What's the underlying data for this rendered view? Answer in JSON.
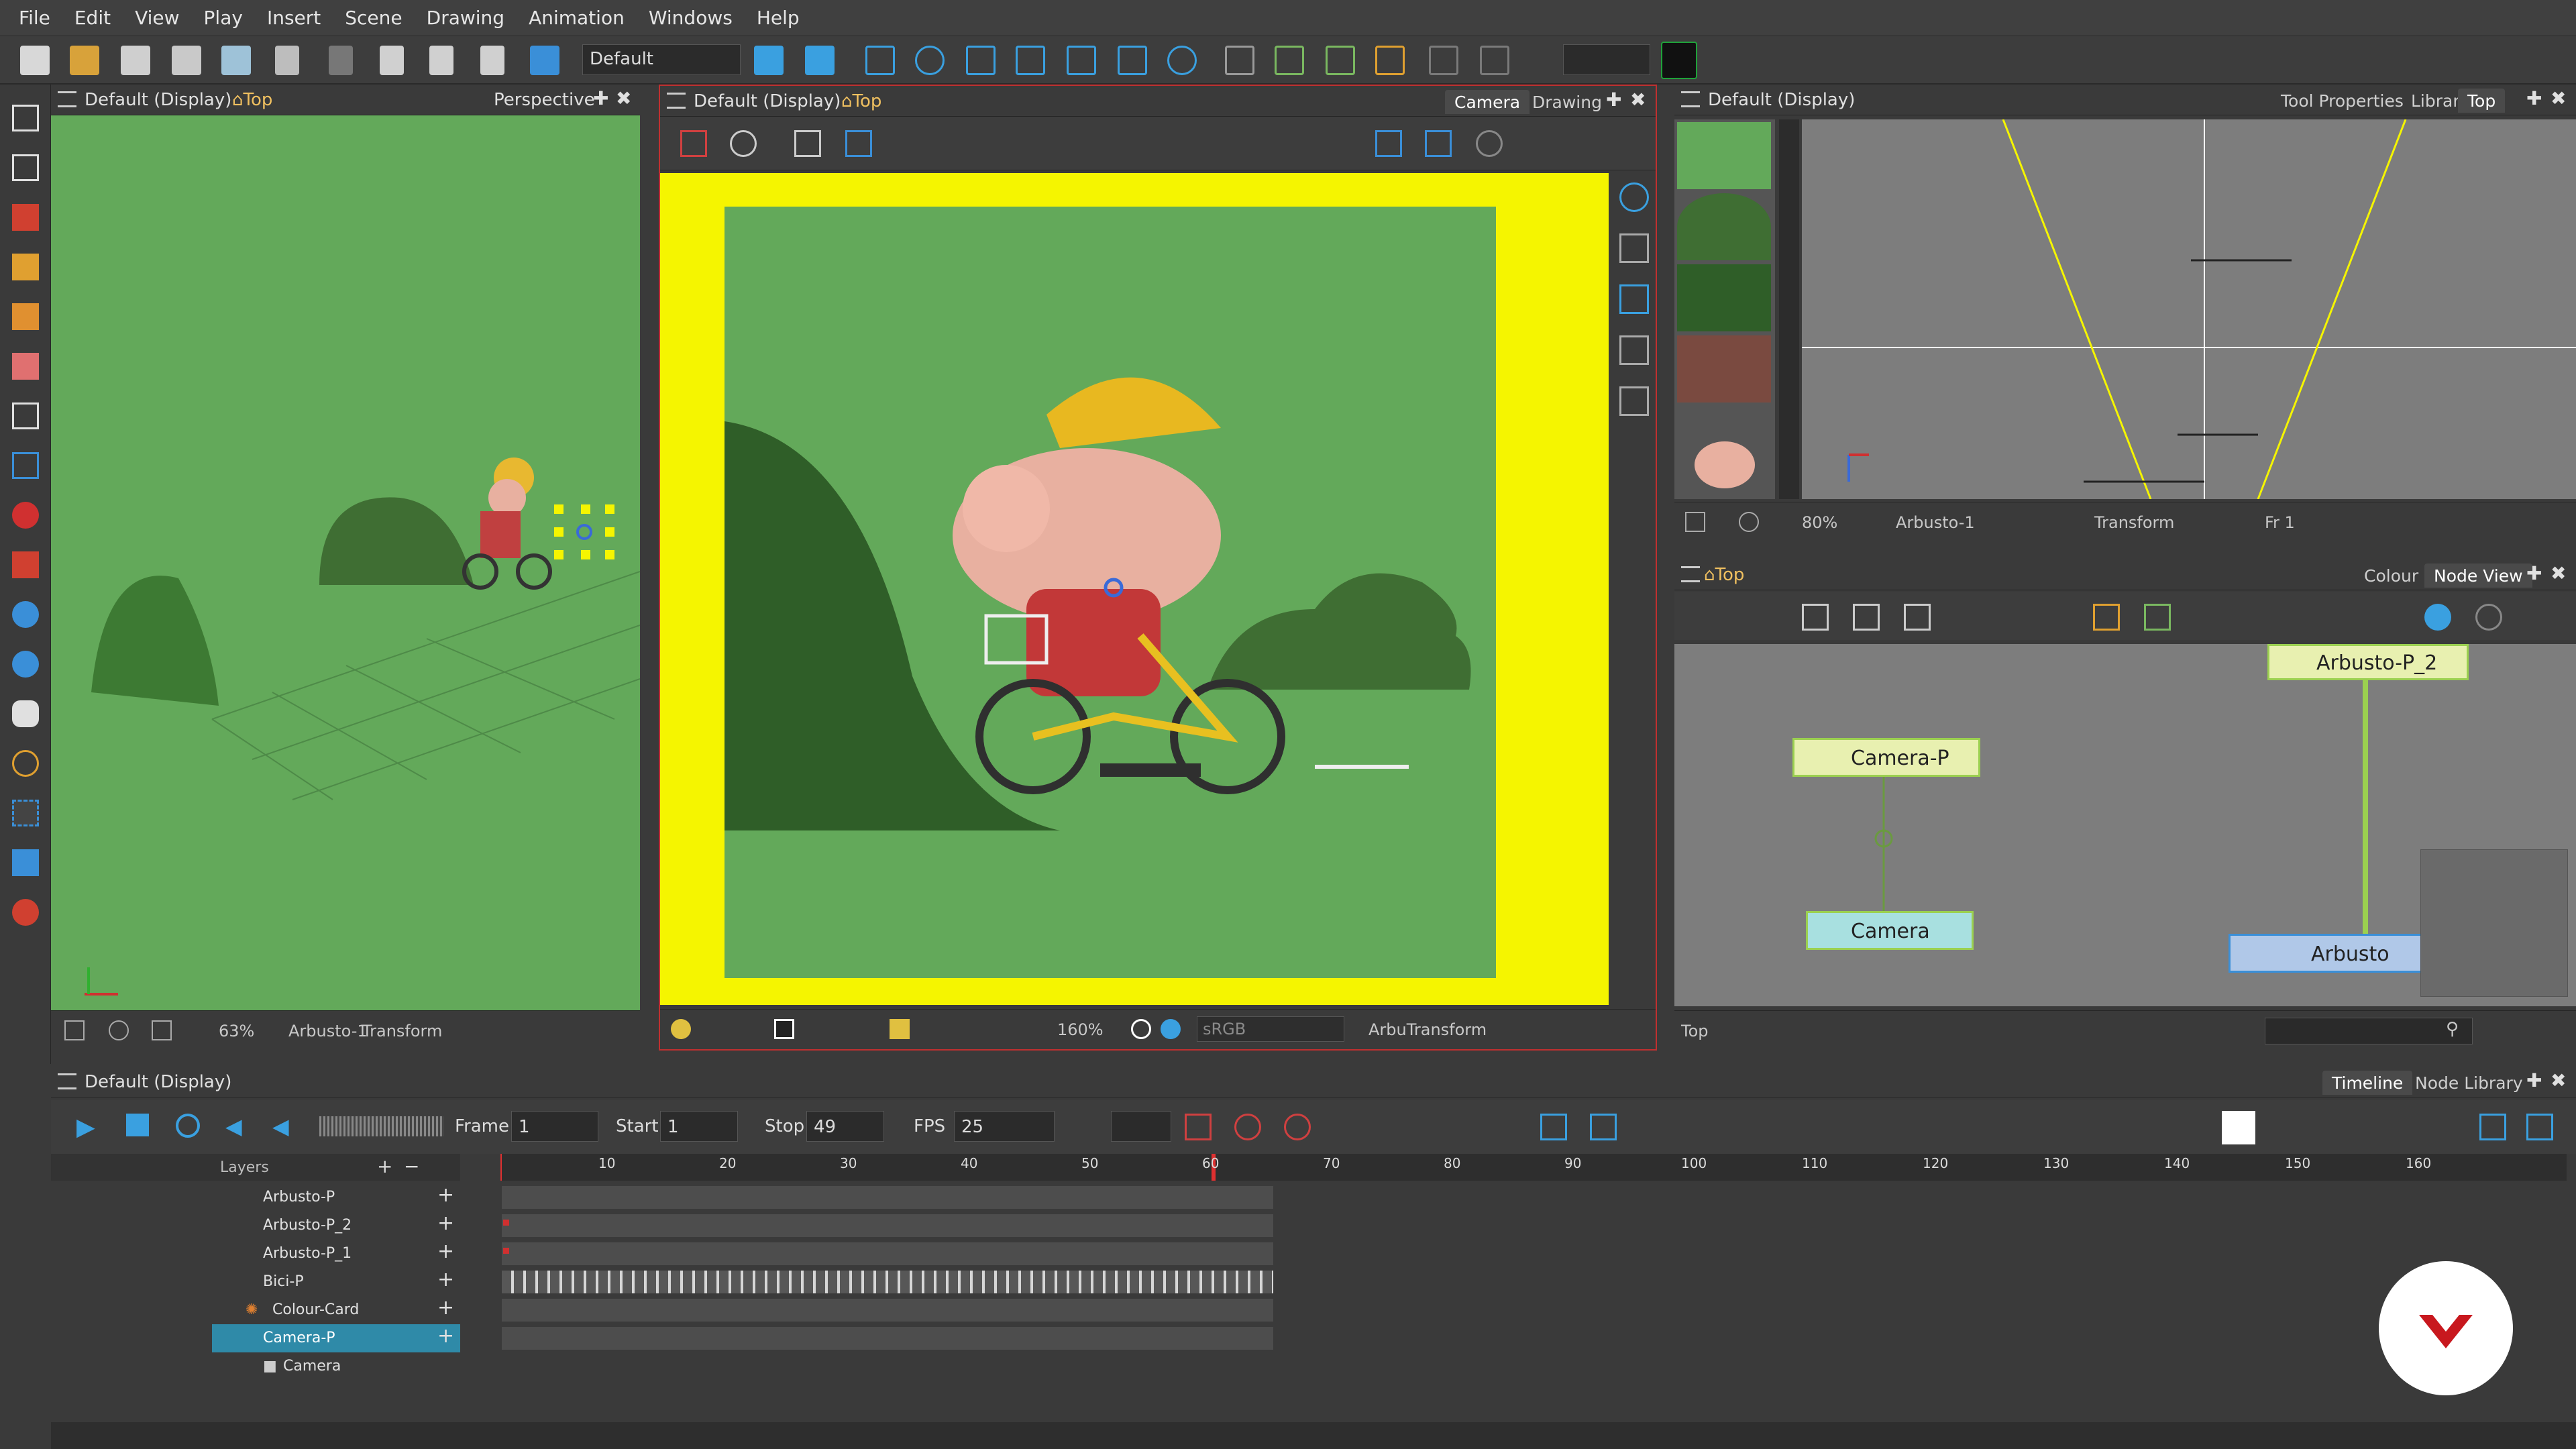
{
  "menu": [
    "File",
    "Edit",
    "View",
    "Play",
    "Insert",
    "Scene",
    "Drawing",
    "Animation",
    "Windows",
    "Help"
  ],
  "toolbar": {
    "workspace": "Default",
    "brand_color": "#1fa23a"
  },
  "left_view": {
    "display": "Default (Display)",
    "view": "Top",
    "mode": "Perspective",
    "zoom": "63%",
    "layer": "Arbusto-1",
    "tool": "Transform"
  },
  "camera_view": {
    "display": "Default (Display)",
    "view": "Top",
    "tabs": [
      "Camera",
      "Drawing"
    ],
    "zoom": "160%",
    "colorspace": "sRGB",
    "status": "ArbuTransform"
  },
  "top_view": {
    "display": "Default (Display)",
    "tabs": [
      "Tool Properties",
      "Library",
      "Top"
    ],
    "zoom": "80%",
    "layer": "Arbusto-1",
    "tool": "Transform",
    "frame": "Fr 1"
  },
  "node_view": {
    "view": "Top",
    "tabs": [
      "Colour",
      "Node View"
    ],
    "nodes": [
      "Camera-P",
      "Camera",
      "Arbusto-P_2",
      "Arbusto"
    ],
    "footer": "Top"
  },
  "timeline": {
    "display": "Default (Display)",
    "tabs": [
      "Timeline",
      "Node Library"
    ],
    "frame_label": "Frame",
    "frame": "1",
    "start_label": "Start",
    "start": "1",
    "stop_label": "Stop",
    "stop": "49",
    "fps_label": "FPS",
    "fps": "25",
    "layers_header": "Layers",
    "layers": [
      "Arbusto-P",
      "Arbusto-P_2",
      "Arbusto-P_1",
      "Bici-P",
      "Colour-Card",
      "Camera-P",
      "Camera"
    ],
    "ruler": [
      "10",
      "20",
      "30",
      "40",
      "50",
      "60",
      "70",
      "80",
      "90",
      "100",
      "110",
      "120",
      "130",
      "140",
      "150",
      "160"
    ]
  },
  "accent": "#f5f500"
}
